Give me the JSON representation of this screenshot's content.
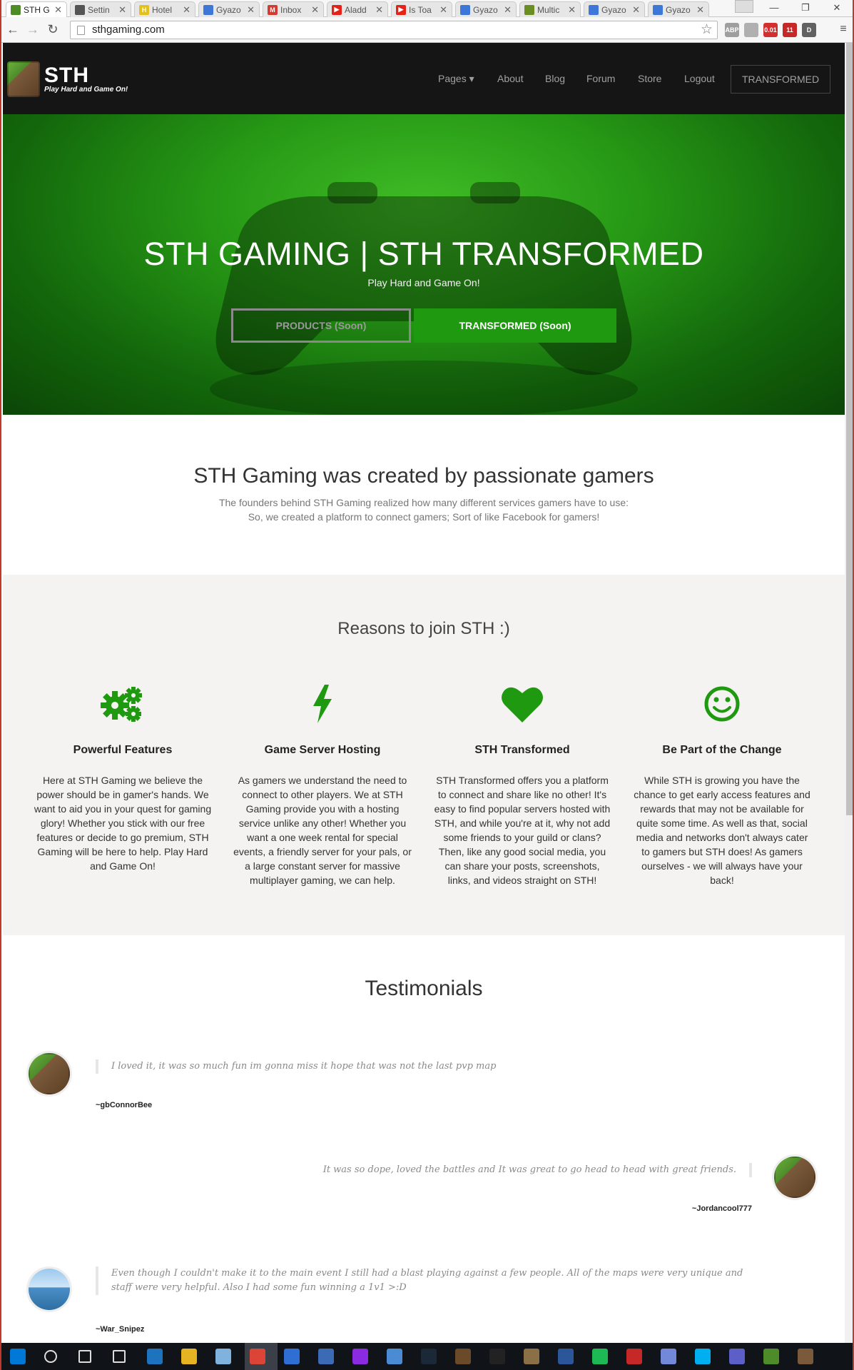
{
  "browser": {
    "tabs": [
      {
        "label": "STH G",
        "color": "#4e8c2a",
        "glyph": ""
      },
      {
        "label": "Settin",
        "color": "#555555",
        "glyph": ""
      },
      {
        "label": "Hotel",
        "color": "#e3c11a",
        "glyph": "H"
      },
      {
        "label": "Gyazo",
        "color": "#3d78d8",
        "glyph": ""
      },
      {
        "label": "Inbox",
        "color": "#d23b2f",
        "glyph": "M"
      },
      {
        "label": "Aladd",
        "color": "#e62117",
        "glyph": "▶"
      },
      {
        "label": "Is Toa",
        "color": "#e62117",
        "glyph": "▶"
      },
      {
        "label": "Gyazo",
        "color": "#3d78d8",
        "glyph": ""
      },
      {
        "label": "Multic",
        "color": "#6b8e23",
        "glyph": ""
      },
      {
        "label": "Gyazo",
        "color": "#3d78d8",
        "glyph": ""
      },
      {
        "label": "Gyazo",
        "color": "#3d78d8",
        "glyph": ""
      }
    ],
    "url": "sthgaming.com",
    "extensions": [
      {
        "name": "abp-icon",
        "label": "ABP",
        "color": "#9e9e9e"
      },
      {
        "name": "chrome-ext-icon",
        "label": "",
        "color": "#b0b0b0"
      },
      {
        "name": "speed-ext-icon",
        "label": "0.01",
        "color": "#d32f2f"
      },
      {
        "name": "mail-ext-icon",
        "label": "11",
        "color": "#c62828"
      },
      {
        "name": "d-ext-icon",
        "label": "D",
        "color": "#616161"
      }
    ]
  },
  "nav": {
    "logo_title": "STH",
    "logo_tagline": "Play Hard and Game On!",
    "links": [
      "Pages ▾",
      "About",
      "Blog",
      "Forum",
      "Store",
      "Logout"
    ],
    "transformed_label": "TRANSFORMED"
  },
  "hero": {
    "title": "STH GAMING | STH TRANSFORMED",
    "subtitle": "Play Hard and Game On!",
    "products_button": "PRODUCTS (Soon)",
    "transformed_button": "TRANSFORMED (Soon)"
  },
  "about": {
    "title": "STH Gaming was created by passionate gamers",
    "line1": "The founders behind STH Gaming realized how many different services gamers have to use:",
    "line2": "So, we created a platform to connect gamers; Sort of like Facebook for gamers!"
  },
  "reasons": {
    "title": "Reasons to join STH :)",
    "accent_color": "#1f9a10",
    "items": [
      {
        "icon": "gears-icon",
        "title": "Powerful Features",
        "text": "Here at STH Gaming we believe the power should be in gamer's hands. We want to aid you in your quest for gaming glory! Whether you stick with our free features or decide to go premium, STH Gaming will be here to help. Play Hard and Game On!"
      },
      {
        "icon": "lightning-icon",
        "title": "Game Server Hosting",
        "text": "As gamers we understand the need to connect to other players. We at STH Gaming provide you with a hosting service unlike any other! Whether you want a one week rental for special events, a friendly server for your pals, or a large constant server for massive multiplayer gaming, we can help."
      },
      {
        "icon": "heart-icon",
        "title": "STH Transformed",
        "text": "STH Transformed offers you a platform to connect and share like no other! It's easy to find popular servers hosted with STH, and while you're at it, why not add some friends to your guild or clans? Then, like any good social media, you can share your posts, screenshots, links, and videos straight on STH!"
      },
      {
        "icon": "smiley-icon",
        "title": "Be Part of the Change",
        "text": "While STH is growing you have the chance to get early access features and rewards that may not be available for quite some time. As well as that, social media and networks don't always cater to gamers but STH does! As gamers ourselves - we will always have your back!"
      }
    ]
  },
  "testimonials": {
    "title": "Testimonials",
    "items": [
      {
        "quote": "I loved it, it was so much fun im gonna miss it hope that was not the last pvp map",
        "author": "~gbConnorBee"
      },
      {
        "quote": "It was so dope, loved the battles and It was great to go head to head with great friends.",
        "author": "~Jordancool777"
      },
      {
        "quote": "Even though I couldn't make it to the main event I still had a blast playing against a few people. All of the maps were very unique and staff were very helpful. Also I had some fun winning a 1v1 >:D",
        "author": "~War_Snipez"
      }
    ]
  }
}
